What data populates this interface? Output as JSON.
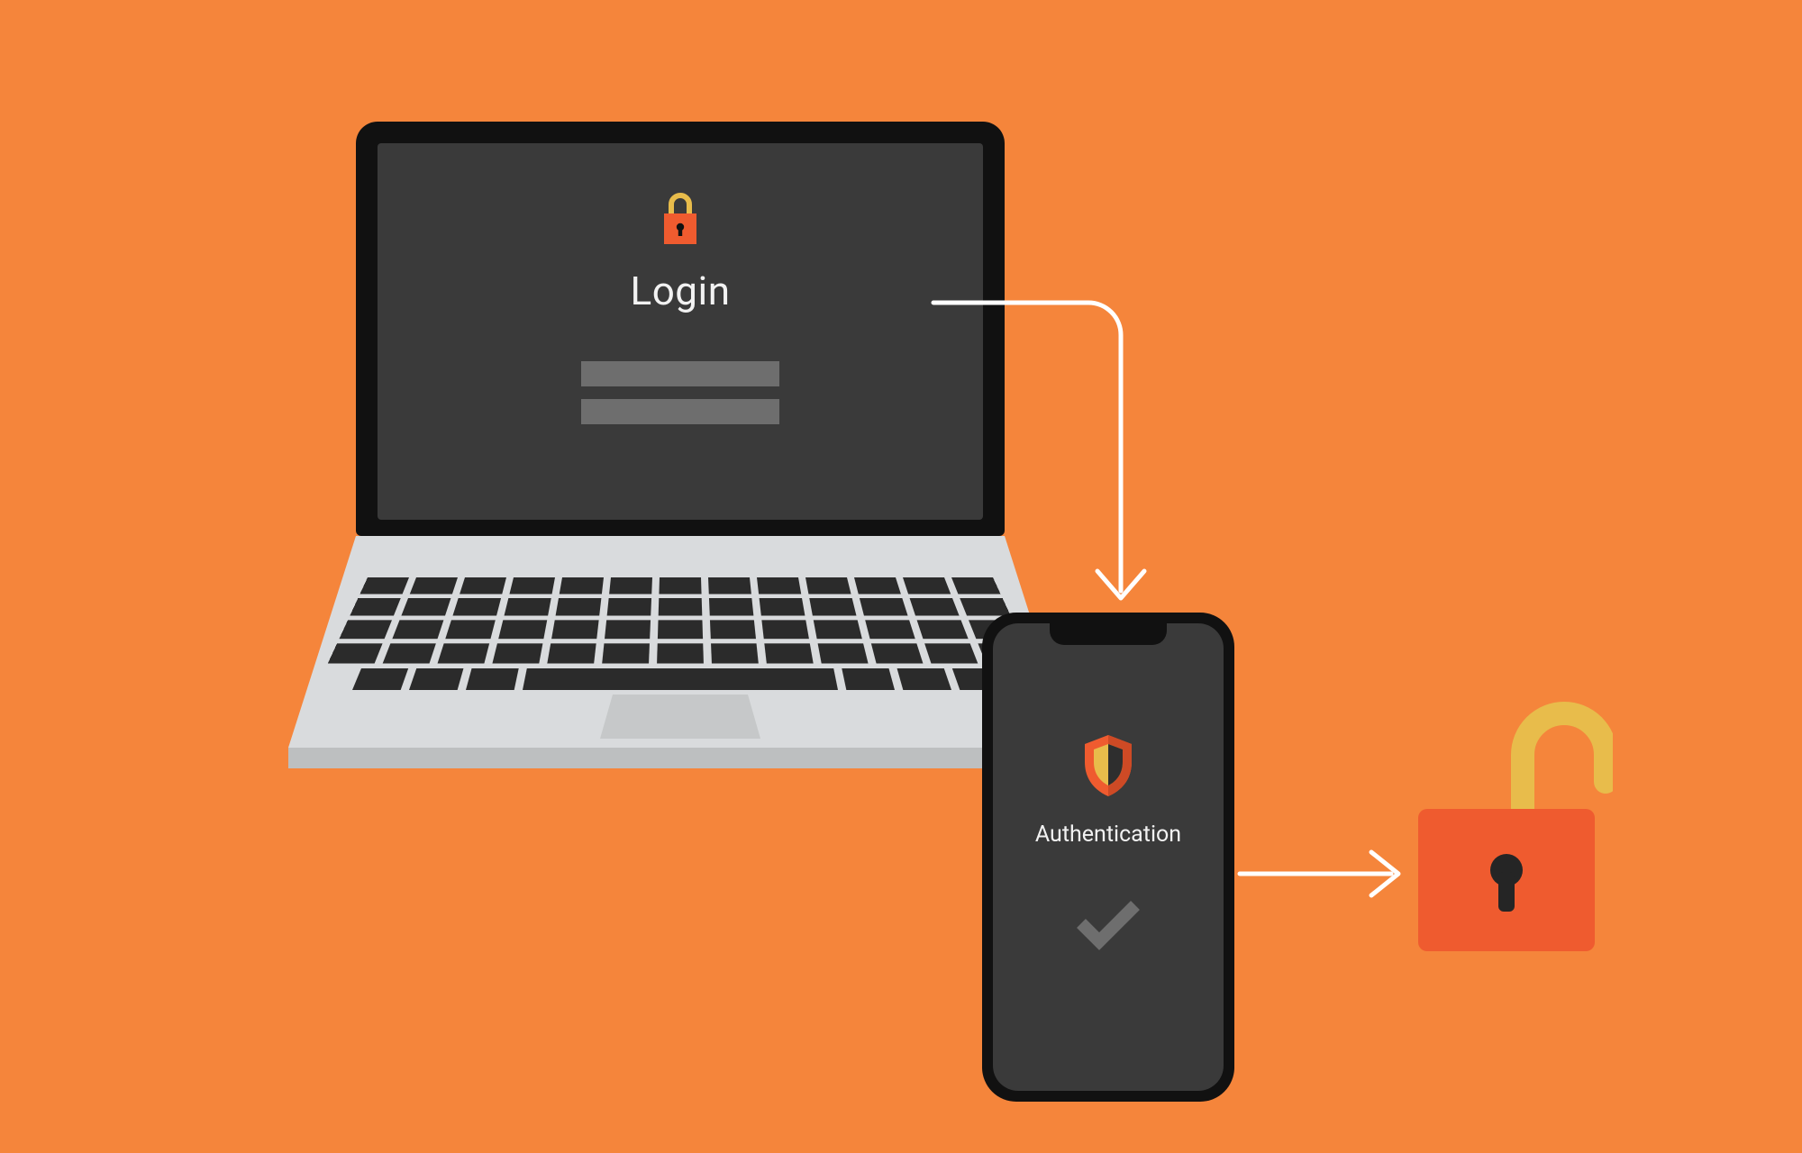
{
  "laptop": {
    "login_label": "Login",
    "lock_icon": "lock-icon"
  },
  "phone": {
    "shield_icon": "shield-icon",
    "auth_label": "Authentication",
    "check_icon": "check-icon"
  },
  "result": {
    "unlocked_icon": "unlocked-padlock-icon"
  },
  "colors": {
    "background": "#F5853B",
    "device_frame": "#111111",
    "screen": "#3A3A3A",
    "field": "#6E6E6E",
    "lock_body": "#EF5B2F",
    "lock_shackle": "#E8BC4B",
    "arrow": "#FFFFFF",
    "laptop_base": "#D9DBDD",
    "laptop_base_edge": "#BDBFC0",
    "check": "#6E6E6E"
  }
}
